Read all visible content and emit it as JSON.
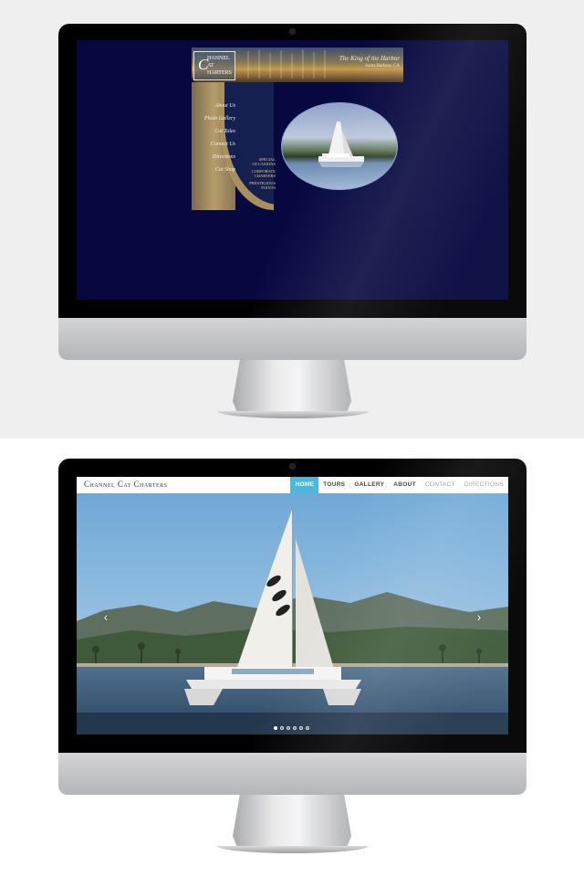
{
  "old_site": {
    "logo_initials": "C",
    "logo_words": [
      "HANNEL",
      "AT",
      "HARTERS"
    ],
    "tagline": "The King of the Harbor",
    "subtagline": "Santa Barbara, CA",
    "nav": [
      "About Us",
      "Photo Gallery",
      "Cat Tales",
      "Contact Us",
      "Directions",
      "Cat Shop"
    ],
    "links": [
      "Special Occasions",
      "Corporate Charters",
      "Prestigious Points"
    ]
  },
  "new_site": {
    "brand": "Channel Cat Charters",
    "nav": [
      {
        "label": "HOME",
        "state": "active"
      },
      {
        "label": "TOURS",
        "state": "normal"
      },
      {
        "label": "GALLERY",
        "state": "normal"
      },
      {
        "label": "ABOUT",
        "state": "normal"
      },
      {
        "label": "CONTACT",
        "state": "muted"
      },
      {
        "label": "DIRECTIONS",
        "state": "muted"
      }
    ],
    "prev_arrow": "‹",
    "next_arrow": "›",
    "slides_total": 6,
    "slide_active": 1,
    "colors": {
      "nav_active": "#4fb6dd",
      "old_background": "#07083f"
    }
  }
}
